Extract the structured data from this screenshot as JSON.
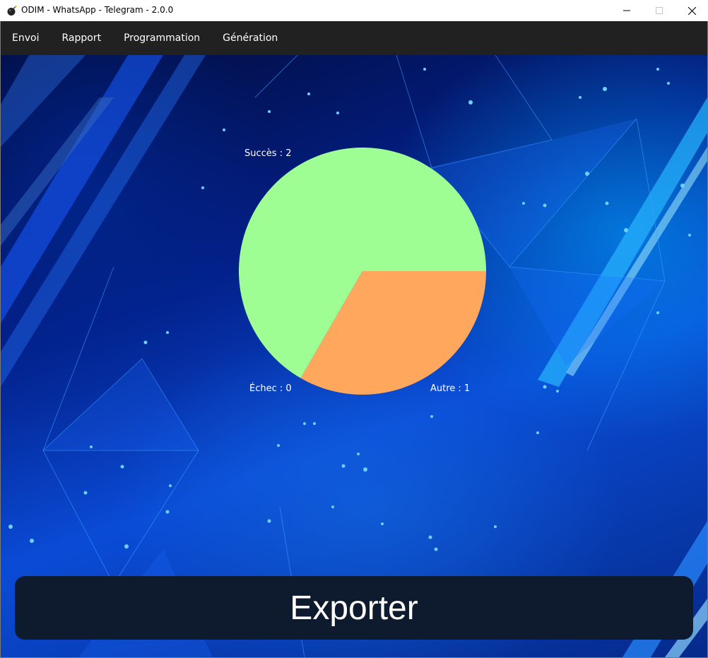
{
  "window": {
    "title": "ODIM - WhatsApp - Telegram - 2.0.0",
    "icon": "bomb-icon"
  },
  "menu": {
    "items": [
      {
        "label": "Envoi"
      },
      {
        "label": "Rapport"
      },
      {
        "label": "Programmation"
      },
      {
        "label": "Génération"
      }
    ]
  },
  "chart_data": {
    "type": "pie",
    "slices": [
      {
        "label": "Succès : 2",
        "name": "Succès",
        "value": 2,
        "color": "#9efe94"
      },
      {
        "label": "Échec : 0",
        "name": "Échec",
        "value": 0,
        "color": "#ff6b6b"
      },
      {
        "label": "Autre : 1",
        "name": "Autre",
        "value": 1,
        "color": "#ffa75c"
      }
    ]
  },
  "actions": {
    "export_label": "Exporter"
  },
  "colors": {
    "menubar_bg": "#212121",
    "button_bg": "#0e1a2e"
  }
}
